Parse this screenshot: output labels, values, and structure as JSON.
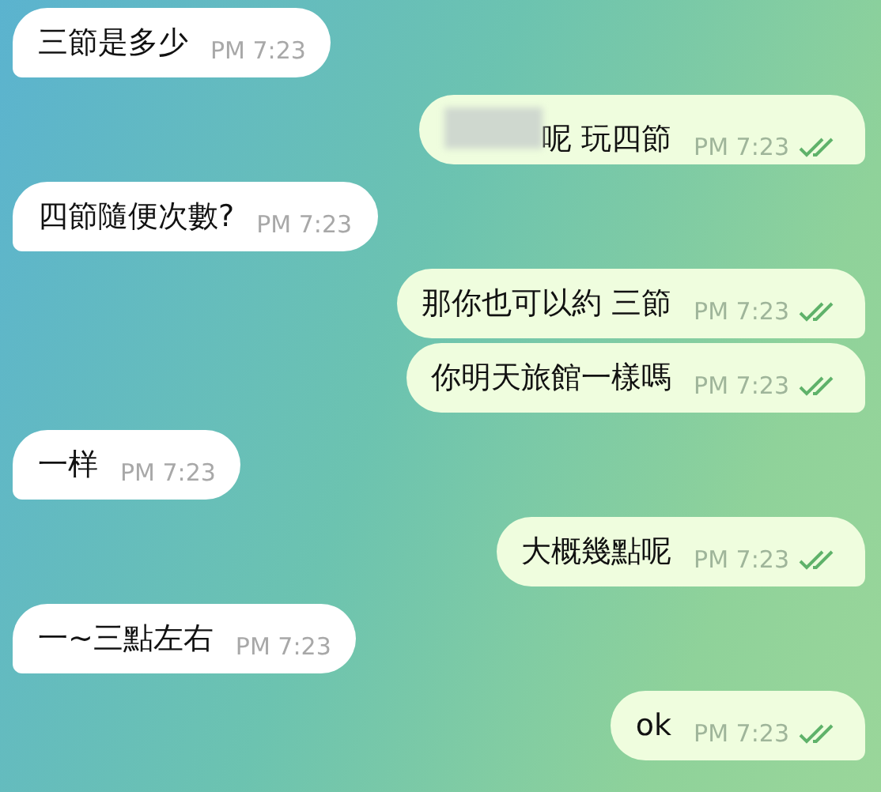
{
  "messages": [
    {
      "text": "三節是多少",
      "time": "PM 7:23",
      "outgoing": false
    },
    {
      "text": "呢 玩四節",
      "time": "PM 7:23",
      "outgoing": true,
      "read": true,
      "redacted": true
    },
    {
      "text": "四節隨便次數?",
      "time": "PM 7:23",
      "outgoing": false
    },
    {
      "text": "那你也可以約 三節",
      "time": "PM 7:23",
      "outgoing": true,
      "read": true
    },
    {
      "text": "你明天旅館一樣嗎",
      "time": "PM 7:23",
      "outgoing": true,
      "read": true
    },
    {
      "text": "一样",
      "time": "PM 7:23",
      "outgoing": false
    },
    {
      "text": "大概幾點呢",
      "time": "PM 7:23",
      "outgoing": true,
      "read": true
    },
    {
      "text": "一~三點左右",
      "time": "PM 7:23",
      "outgoing": false
    },
    {
      "text": "ok",
      "time": "PM 7:23",
      "outgoing": true,
      "read": true
    }
  ]
}
